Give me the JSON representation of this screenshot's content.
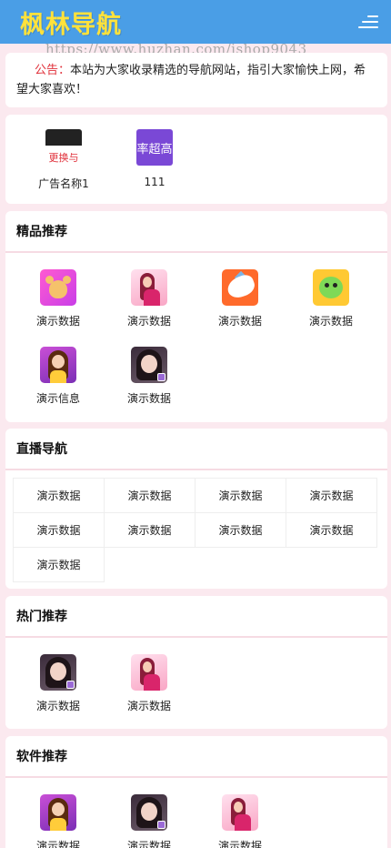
{
  "header": {
    "logo": "枫林导航",
    "menu_icon": "menu-icon"
  },
  "watermark": "https://www.huzhan.com/ishop9043",
  "notice": {
    "label": "公告：",
    "text": "本站为大家收录精选的导航网站，指引大家愉快上网，希望大家喜欢！"
  },
  "ads": [
    {
      "label": "广告名称1",
      "thumb_text": "更换与"
    },
    {
      "label": "111",
      "thumb_text": "率超高"
    }
  ],
  "featured": {
    "title": "精品推荐",
    "items": [
      {
        "label": "演示数据",
        "icon": "deer-icon"
      },
      {
        "label": "演示数据",
        "icon": "girl-pink-icon"
      },
      {
        "label": "演示数据",
        "icon": "shark-icon"
      },
      {
        "label": "演示数据",
        "icon": "dragon-icon"
      },
      {
        "label": "演示信息",
        "icon": "girl-purple-icon"
      },
      {
        "label": "演示数据",
        "icon": "selfie-icon"
      }
    ]
  },
  "live": {
    "title": "直播导航",
    "items": [
      "演示数据",
      "演示数据",
      "演示数据",
      "演示数据",
      "演示数据",
      "演示数据",
      "演示数据",
      "演示数据",
      "演示数据"
    ]
  },
  "hot": {
    "title": "热门推荐",
    "items": [
      {
        "label": "演示数据",
        "icon": "selfie-icon"
      },
      {
        "label": "演示数据",
        "icon": "girl-pink-icon"
      }
    ]
  },
  "software": {
    "title": "软件推荐",
    "items": [
      {
        "label": "演示数据",
        "icon": "girl-purple-icon"
      },
      {
        "label": "演示数据",
        "icon": "selfie-icon"
      },
      {
        "label": "演示数据",
        "icon": "girl-pink-icon"
      }
    ]
  },
  "colors": {
    "header": "#4a9ee6",
    "logo": "#ffe23b",
    "notice_label": "#e0303a",
    "background": "#fbe9ef"
  }
}
